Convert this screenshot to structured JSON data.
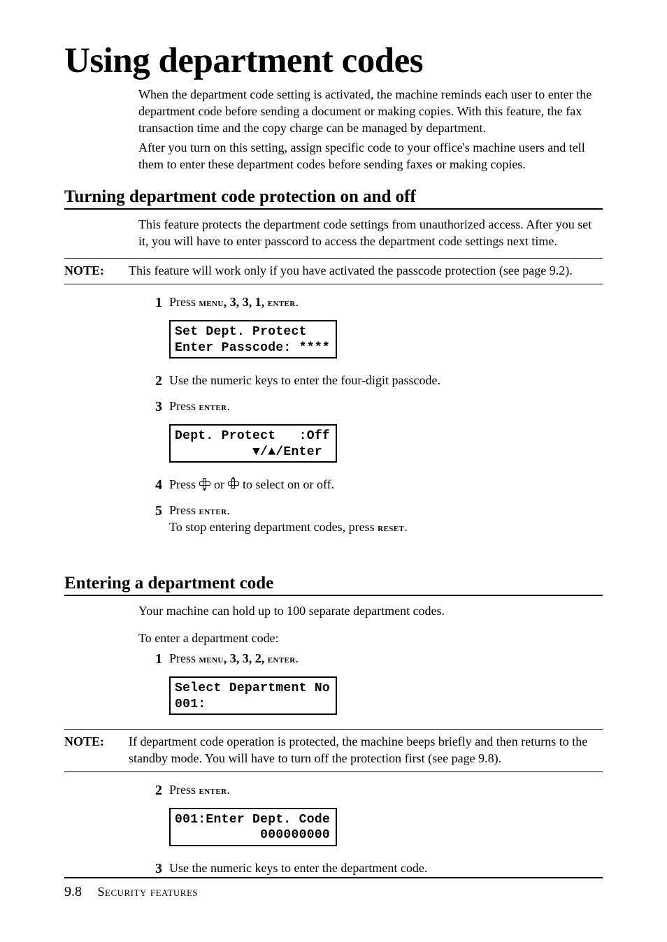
{
  "title": "Using department codes",
  "intro": [
    "When the department code setting is activated, the machine reminds each user to enter the department code before sending a document or making copies.  With this feature, the fax transaction time and the copy charge can be managed by department.",
    "After you turn on this setting, assign specific code to your office's machine users and tell them to enter these department codes before sending faxes or making copies."
  ],
  "sections": [
    {
      "heading": "Turning department code protection on and off",
      "intro": "This feature protects the department code settings from unauthorized access. After you set it, you will have to enter passcord to access the department code settings next time.",
      "note": "This feature will work only if you have activated the passcode protection (see page 9.2).",
      "steps": {
        "s1": {
          "num": "1",
          "prefix": "Press ",
          "menu": "menu",
          "seq": ", 3, 3, 1, ",
          "enter": "enter",
          "tail": ".",
          "lcd": "Set Dept. Protect   \nEnter Passcode: ****"
        },
        "s2": {
          "num": "2",
          "text": "Use the numeric keys to enter the four-digit passcode."
        },
        "s3": {
          "num": "3",
          "prefix": "Press ",
          "enter": "enter",
          "tail": ".",
          "lcd": "Dept. Protect   :Off\n          ▼/▲/Enter"
        },
        "s4": {
          "num": "4",
          "pre": "Press ",
          "mid": " or ",
          "post": " to select on or off."
        },
        "s5": {
          "num": "5",
          "prefix": "Press ",
          "enter": "enter",
          "tail": ".",
          "line2a": "To stop entering department codes, press ",
          "reset": "reset",
          "line2b": "."
        }
      }
    },
    {
      "heading": "Entering a department code",
      "intro1": "Your machine can hold up to 100 separate department codes.",
      "intro2": "To enter a department code:",
      "note": "If department code operation is protected, the machine beeps briefly and then returns to the standby mode. You will have to turn off the protection first (see page 9.8).",
      "steps": {
        "s1": {
          "num": "1",
          "prefix": "Press ",
          "menu": "menu",
          "seq": ", 3, 3, 2, ",
          "enter": "enter",
          "tail": ".",
          "lcd": "Select Department No\n001:"
        },
        "s2": {
          "num": "2",
          "prefix": "Press ",
          "enter": "enter",
          "tail": ".",
          "lcd": "001:Enter Dept. Code\n           000000000"
        },
        "s3": {
          "num": "3",
          "text": "Use the numeric keys to enter the department code."
        }
      }
    }
  ],
  "note_label": "NOTE:",
  "footer": {
    "page": "9.8",
    "chapter": "Security features"
  }
}
